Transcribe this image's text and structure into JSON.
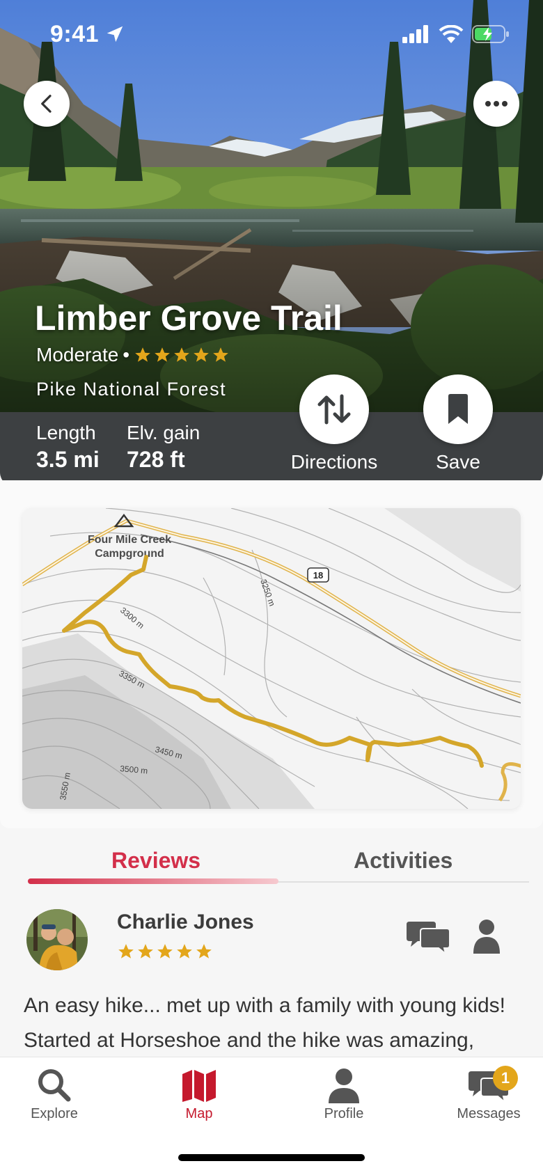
{
  "status_bar": {
    "time": "9:41"
  },
  "trail": {
    "title": "Limber Grove Trail",
    "difficulty": "Moderate",
    "separator": "•",
    "rating_stars": 5,
    "forest": "Pike National Forest"
  },
  "stats": {
    "length_label": "Length",
    "length_value": "3.5 mi",
    "elev_label": "Elv. gain",
    "elev_value": "728 ft"
  },
  "actions": {
    "directions_label": "Directions",
    "save_label": "Save"
  },
  "map": {
    "campground_line1": "Four Mile Creek",
    "campground_line2": "Campground",
    "road_number": "18",
    "contours": [
      "3300 m",
      "3250 m",
      "3350 m",
      "3450 m",
      "3500 m",
      "3550 m"
    ]
  },
  "tabs": {
    "reviews": "Reviews",
    "activities": "Activities",
    "active": "reviews"
  },
  "review": {
    "name": "Charlie Jones",
    "stars": 5,
    "text_line1": "An easy hike... met up with a family with young kids!",
    "text_line2": "Started at Horseshoe and the hike was amazing,"
  },
  "nav": {
    "explore": "Explore",
    "map": "Map",
    "profile": "Profile",
    "messages": "Messages",
    "messages_badge": "1",
    "active": "map"
  },
  "colors": {
    "accent": "#c5192d",
    "star": "#e3a61b",
    "stats_bar": "#3d4042",
    "trail_line": "#d4a62a"
  }
}
